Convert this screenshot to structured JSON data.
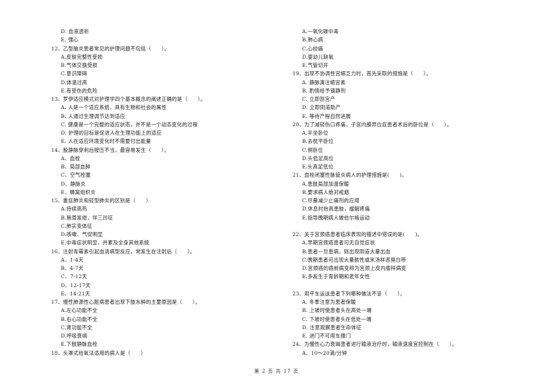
{
  "page": {
    "footer": "第 2 页 共 17 页"
  },
  "left_column": [
    {
      "type": "opt",
      "text": "D. 血液透析"
    },
    {
      "type": "opt",
      "text": "E. 强心"
    },
    {
      "type": "q",
      "text": "12、乙型脑炎患者常见的护理问题不包括（　　）。"
    },
    {
      "type": "opt",
      "text": "A.皮肤完整性受损"
    },
    {
      "type": "opt",
      "text": "B.气体交换受损"
    },
    {
      "type": "opt",
      "text": "C.意识障碍"
    },
    {
      "type": "opt",
      "text": "D.体温过高"
    },
    {
      "type": "opt",
      "text": "E.有受伤的危险"
    },
    {
      "type": "q",
      "text": "13、罗伊适应模式对护理学四个基本概念的阐述正确的是（　　）。"
    },
    {
      "type": "opt",
      "text": "A. 人是一个适应系统，具有生物和社会的属性"
    },
    {
      "type": "opt",
      "text": "B. 人通过生理调节达到适应"
    },
    {
      "type": "opt",
      "text": "C. 健康是一个完整的适应状态，并不是一个动态变化的过程"
    },
    {
      "type": "opt",
      "text": "D. 护理的目标是促进人在生理功能上的适应"
    },
    {
      "type": "opt",
      "text": "E. 人在适应环境变化时不需要付出能量"
    },
    {
      "type": "q",
      "text": "14、股静脉穿刺后按压不当，最容易发生（　　）。"
    },
    {
      "type": "opt",
      "text": "A、血栓"
    },
    {
      "type": "opt",
      "text": "B、局部血肿"
    },
    {
      "type": "opt",
      "text": "C、空气栓塞"
    },
    {
      "type": "opt",
      "text": "D、静脉炎"
    },
    {
      "type": "opt",
      "text": "E、蜂窝组织炎"
    },
    {
      "type": "q",
      "text": "15、重症肺炎和轻型肺炎的区别是（　　）"
    },
    {
      "type": "opt",
      "text": "A.持续高热"
    },
    {
      "type": "opt",
      "text": "B.唇周发绀，伴三凹征"
    },
    {
      "type": "opt",
      "text": "C.肺实变体征"
    },
    {
      "type": "opt",
      "text": "D.咳嗽、气促明显"
    },
    {
      "type": "opt",
      "text": "E.中毒症状明显，并累及全身其他系统"
    },
    {
      "type": "q",
      "text": "16、注射青霉素引起血清病型反应，常发生在注射后（　　）。"
    },
    {
      "type": "opt",
      "text": "A、1-4天"
    },
    {
      "type": "opt",
      "text": "B、4-7天"
    },
    {
      "type": "opt",
      "text": "C、7-12天"
    },
    {
      "type": "opt",
      "text": "D、12-17天"
    },
    {
      "type": "opt",
      "text": "E、14-21天"
    },
    {
      "type": "q",
      "text": "17、慢性肺源性心脏病患者出现下肢水肿的主要原因是（　　）。"
    },
    {
      "type": "opt",
      "text": "A.左心功能不全"
    },
    {
      "type": "opt",
      "text": "B.右心功能不全"
    },
    {
      "type": "opt",
      "text": "C.肾功能不全"
    },
    {
      "type": "opt",
      "text": "D.呼吸衰竭"
    },
    {
      "type": "opt",
      "text": "E.下肢静脉血栓"
    },
    {
      "type": "q",
      "text": "18、头罩式给氧法适用的病人是（　　）"
    }
  ],
  "right_column": [
    {
      "type": "opt",
      "text": "A.一氧化碳中毒"
    },
    {
      "type": "opt",
      "text": "B.肺心病"
    },
    {
      "type": "opt",
      "text": "C.心绞痛"
    },
    {
      "type": "opt",
      "text": "D.婴幼儿缺氧"
    },
    {
      "type": "opt",
      "text": "E.气管切开"
    },
    {
      "type": "q",
      "text": "19、出现不协调性宫缩乏力时，首先采取的措施是（　　）。"
    },
    {
      "type": "opt",
      "text": "A. 静脉滴注缩宫素"
    },
    {
      "type": "opt",
      "text": "B. 酌情给予镇静剂"
    },
    {
      "type": "opt",
      "text": "C. 立即剖宫产"
    },
    {
      "type": "opt",
      "text": "D. 立即阴道助产"
    },
    {
      "type": "opt",
      "text": "E. 等待产程自然进展"
    },
    {
      "type": "q",
      "text": "20、为了减轻伤口疼痛，子宫内膜异位症患者术后的卧位是（　　）。"
    },
    {
      "type": "opt",
      "text": "A.半坐卧位"
    },
    {
      "type": "opt",
      "text": "B.去枕平卧位"
    },
    {
      "type": "opt",
      "text": "C.侧卧位"
    },
    {
      "type": "opt",
      "text": "D.头低足高位"
    },
    {
      "type": "opt",
      "text": "E.头高足低位"
    },
    {
      "type": "q",
      "text": "21、血栓闭塞性脉管炎病人的护理措施是(　　)。"
    },
    {
      "type": "opt",
      "text": "A.患肢局部加温保暖"
    },
    {
      "type": "opt",
      "text": "B.要求病人绝对戒烟"
    },
    {
      "type": "opt",
      "text": "C.尽量减少止痛剂的应用"
    },
    {
      "type": "opt",
      "text": "D.休息时抬高患肢，缓解疼痛"
    },
    {
      "type": "opt",
      "text": "E.指导晚期病人做伯尔格运动"
    },
    {
      "type": "gap",
      "text": ""
    },
    {
      "type": "q",
      "text": "22、关于宫颈癌患者临床表现的描述中错误的是(　　)。"
    },
    {
      "type": "opt",
      "text": "A.早期宫颈癌患者可无自觉症状"
    },
    {
      "type": "opt",
      "text": "B.患者一旦患病，则出现阴道大量出血"
    },
    {
      "type": "opt",
      "text": "C.晚期患者可出现大量脓性或米汤样恶臭白带"
    },
    {
      "type": "opt",
      "text": "D.宫颈癌的癌前病变称为宫颈上皮内瘤样病变"
    },
    {
      "type": "opt",
      "text": "E.多发生于育龄期和老年女性"
    },
    {
      "type": "gap",
      "text": ""
    },
    {
      "type": "q",
      "text": "23、用平车运送患者下列哪种做法不妥（　　）。"
    },
    {
      "type": "opt",
      "text": "A. 冬季注意为患者保暖"
    },
    {
      "type": "opt",
      "text": "B. 上坡时使患者头在高处一端"
    },
    {
      "type": "opt",
      "text": "C. 下坡时使患者头在低处一端"
    },
    {
      "type": "opt",
      "text": "D. 注意观察患者生命体征"
    },
    {
      "type": "opt",
      "text": "E. 进门不可用车撞门"
    },
    {
      "type": "q",
      "text": "24、为慢性心力衰竭患者进行输液治疗时，输液速度宜控制在（　　）。"
    },
    {
      "type": "opt",
      "text": "A、10～20滴/分钟"
    }
  ]
}
